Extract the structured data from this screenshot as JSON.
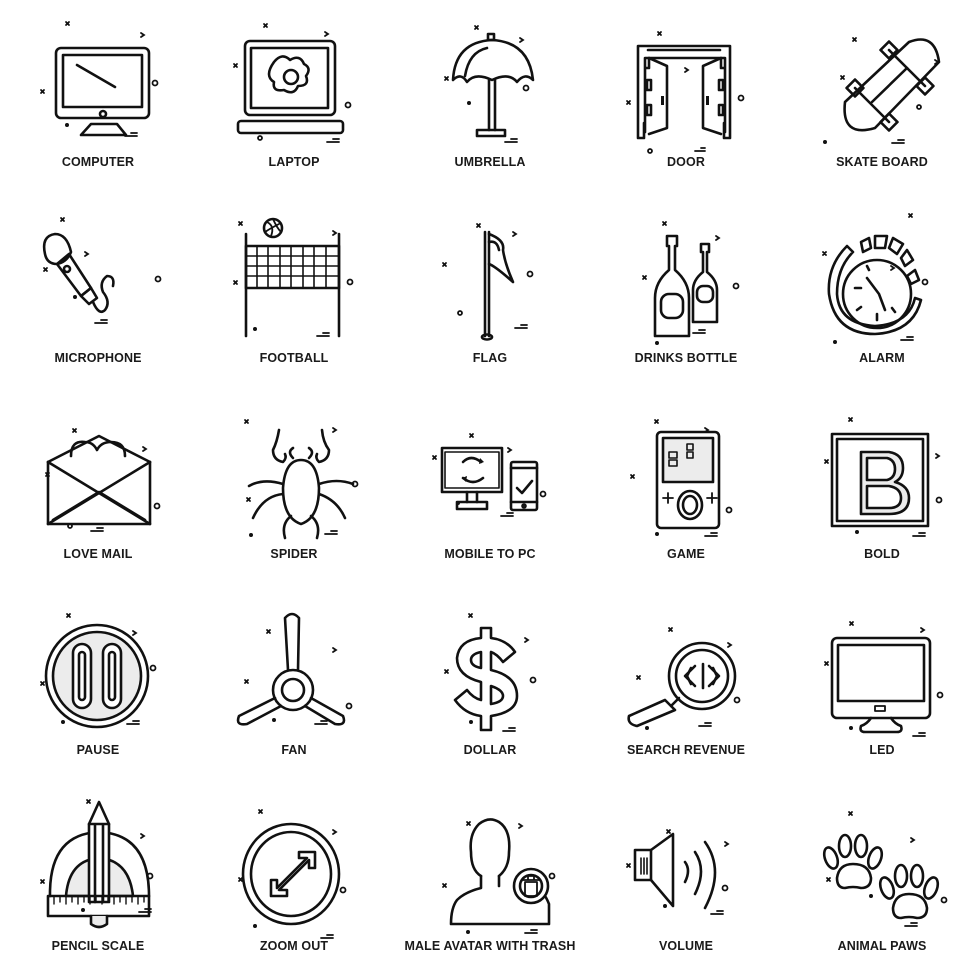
{
  "icon_sheet": {
    "stroke_color": "#111111",
    "fill_color": "#ececec",
    "background": "#ffffff",
    "items": [
      {
        "label": "COMPUTER",
        "icon": "computer-icon"
      },
      {
        "label": "LAPTOP",
        "icon": "laptop-icon"
      },
      {
        "label": "UMBRELLA",
        "icon": "umbrella-icon"
      },
      {
        "label": "DOOR",
        "icon": "door-icon"
      },
      {
        "label": "SKATE BOARD",
        "icon": "skateboard-icon"
      },
      {
        "label": "MICROPHONE",
        "icon": "microphone-icon"
      },
      {
        "label": "FOOTBALL",
        "icon": "football-net-icon"
      },
      {
        "label": "FLAG",
        "icon": "flag-icon"
      },
      {
        "label": "DRINKS BOTTLE",
        "icon": "bottles-icon"
      },
      {
        "label": "ALARM",
        "icon": "alarm-clock-icon"
      },
      {
        "label": "LOVE MAIL",
        "icon": "love-mail-icon"
      },
      {
        "label": "SPIDER",
        "icon": "spider-icon"
      },
      {
        "label": "MOBILE TO PC",
        "icon": "mobile-to-pc-icon"
      },
      {
        "label": "GAME",
        "icon": "handheld-game-icon"
      },
      {
        "label": "BOLD",
        "icon": "bold-icon"
      },
      {
        "label": "PAUSE",
        "icon": "pause-icon"
      },
      {
        "label": "FAN",
        "icon": "fan-icon"
      },
      {
        "label": "DOLLAR",
        "icon": "dollar-icon"
      },
      {
        "label": "SEARCH REVENUE",
        "icon": "search-code-icon"
      },
      {
        "label": "LED",
        "icon": "led-monitor-icon"
      },
      {
        "label": "PENCIL SCALE",
        "icon": "pencil-scale-icon"
      },
      {
        "label": "ZOOM OUT",
        "icon": "zoom-out-icon"
      },
      {
        "label": "MALE AVATAR WITH TRASH",
        "icon": "avatar-trash-icon"
      },
      {
        "label": "VOLUME",
        "icon": "volume-icon"
      },
      {
        "label": "ANIMAL PAWS",
        "icon": "animal-paws-icon"
      }
    ]
  }
}
